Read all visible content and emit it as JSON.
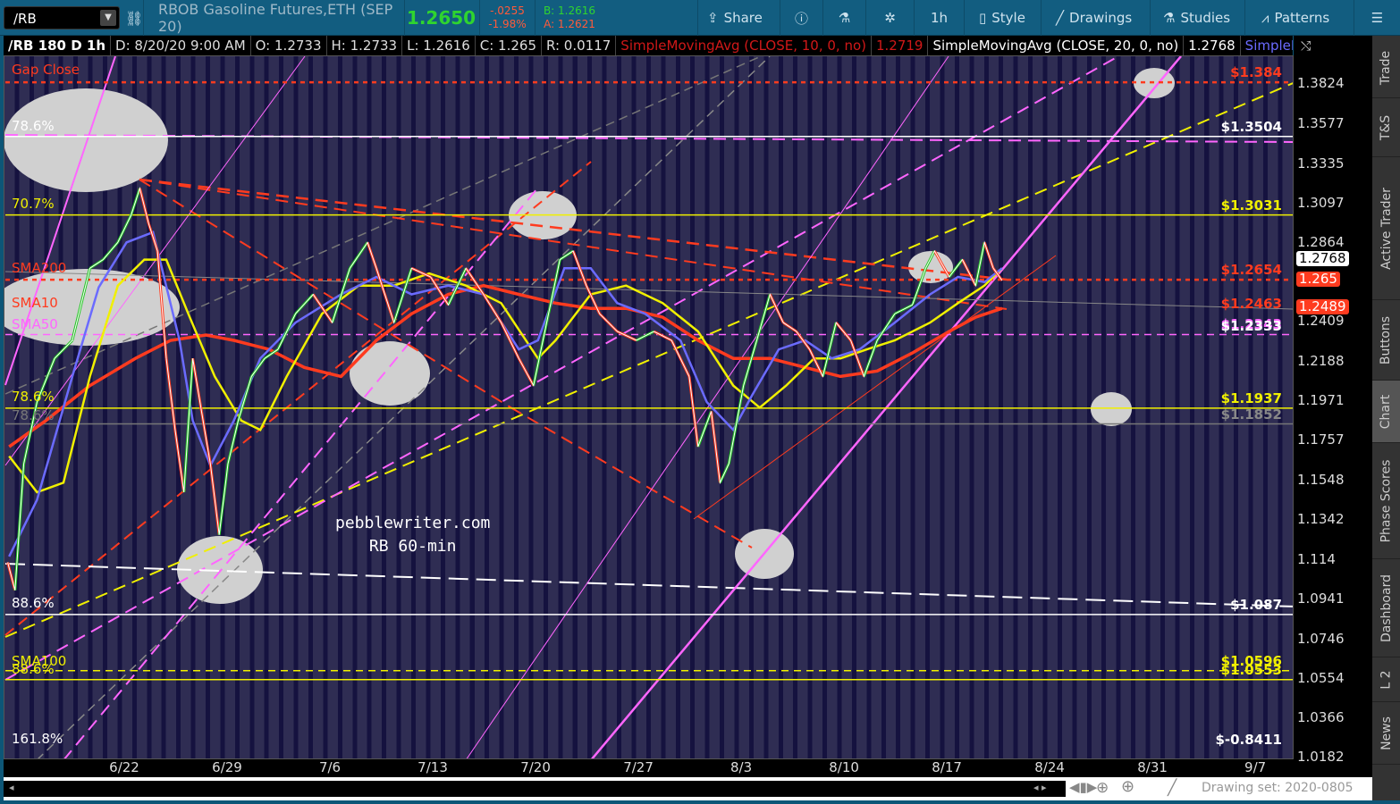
{
  "toolbar": {
    "symbol": "/RB",
    "description": "RBOB Gasoline Futures,ETH (SEP 20)",
    "last": "1.2650",
    "change": "-.0255",
    "change_pct": "-1.98%",
    "bid": "B: 1.2616",
    "ask": "A: 1.2621",
    "share": "Share",
    "interval": "1h",
    "style": "Style",
    "drawings": "Drawings",
    "studies": "Studies",
    "patterns": "Patterns"
  },
  "infobar": {
    "title": "/RB 180 D 1h",
    "date": "D: 8/20/20 9:00 AM",
    "open": "O: 1.2733",
    "high": "H: 1.2733",
    "low": "L: 1.2616",
    "close": "C: 1.265",
    "range": "R: 0.0117",
    "study1": "SimpleMovingAvg (CLOSE, 10, 0, no)",
    "study1_val": "1.2719",
    "study2": "SimpleMovingAvg (CLOSE, 20, 0, no)",
    "study2_val": "1.2768",
    "study3": "SimpleMoving..."
  },
  "price_axis": {
    "ticks": [
      "1.3824",
      "1.3577",
      "1.3335",
      "1.3097",
      "1.2864",
      "1.2409",
      "1.2188",
      "1.1971",
      "1.1757",
      "1.1548",
      "1.1342",
      "1.114",
      "1.0941",
      "1.0746",
      "1.0554",
      "1.0366",
      "1.0182"
    ],
    "badges": [
      {
        "text": "1.2768",
        "price": 1.2768,
        "bg": "#ffffff",
        "fg": "#000000"
      },
      {
        "text": "1.265",
        "price": 1.265,
        "bg": "#ff3b1f",
        "fg": "#ffffff"
      },
      {
        "text": "1.2489",
        "price": 1.2489,
        "bg": "#ff3b1f",
        "fg": "#ffffff"
      }
    ]
  },
  "date_axis": [
    {
      "label": "6/22",
      "day": 0
    },
    {
      "label": "6/29",
      "day": 7
    },
    {
      "label": "7/6",
      "day": 14
    },
    {
      "label": "7/13",
      "day": 21
    },
    {
      "label": "7/20",
      "day": 28
    },
    {
      "label": "7/27",
      "day": 35
    },
    {
      "label": "8/3",
      "day": 42
    },
    {
      "label": "8/10",
      "day": 49
    },
    {
      "label": "8/17",
      "day": 56
    },
    {
      "label": "8/24",
      "day": 63
    },
    {
      "label": "8/31",
      "day": 70
    },
    {
      "label": "9/7",
      "day": 77
    }
  ],
  "levels": [
    {
      "label": "$1.384",
      "price": 1.384,
      "color": "#ff3b1f",
      "style": "dotted"
    },
    {
      "label": "$1.3504",
      "price": 1.3504,
      "color": "#ffffff",
      "style": "solid"
    },
    {
      "label": "$1.3031",
      "price": 1.3031,
      "color": "#f0f000",
      "style": "solid"
    },
    {
      "label": "$1.2654",
      "price": 1.2654,
      "color": "#ff3b1f",
      "style": "dotted"
    },
    {
      "label": "$1.2463",
      "price": 1.2463,
      "color": "#ff3b1f",
      "style": "none"
    },
    {
      "label": "$1.2343",
      "price": 1.2343,
      "color": "#ff66ff",
      "style": "dashed"
    },
    {
      "label": "$1.2333",
      "price": 1.2333,
      "color": "#ffffff",
      "style": "none"
    },
    {
      "label": "$1.1937",
      "price": 1.1937,
      "color": "#f0f000",
      "style": "solid"
    },
    {
      "label": "$1.1852",
      "price": 1.1852,
      "color": "#777777",
      "style": "solid"
    },
    {
      "label": "$1.087",
      "price": 1.087,
      "color": "#ffffff",
      "style": "solid"
    },
    {
      "label": "$1.0596",
      "price": 1.0596,
      "color": "#f0f000",
      "style": "dashed"
    },
    {
      "label": "$1.0553",
      "price": 1.0553,
      "color": "#f0f000",
      "style": "solid"
    },
    {
      "label": "$-0.8411",
      "price": 1.0225,
      "color": "#ffffff",
      "style": "none"
    }
  ],
  "left_labels": [
    {
      "text": "Gap Close",
      "price": 1.387,
      "color": "#ff3b1f"
    },
    {
      "text": "78.6%",
      "price": 1.352,
      "color": "#ffffff"
    },
    {
      "text": "70.7%",
      "price": 1.305,
      "color": "#f0f000"
    },
    {
      "text": "SMA200",
      "price": 1.2675,
      "color": "#ff3b1f"
    },
    {
      "text": "SMA10",
      "price": 1.2475,
      "color": "#ff3b1f"
    },
    {
      "text": "SMA50",
      "price": 1.2355,
      "color": "#ff66ff"
    },
    {
      "text": "78.6%",
      "price": 1.1955,
      "color": "#f0f000"
    },
    {
      "text": "78.6%",
      "price": 1.1855,
      "color": "#777777"
    },
    {
      "text": "88.6%",
      "price": 1.0885,
      "color": "#ffffff"
    },
    {
      "text": "SMA100",
      "price": 1.0605,
      "color": "#f0f000"
    },
    {
      "text": "88.6%",
      "price": 1.0565,
      "color": "#f0f000"
    },
    {
      "text": "161.8%",
      "price": 1.0235,
      "color": "#ffffff"
    }
  ],
  "watermark": {
    "line1": "pebblewriter.com",
    "line2": "RB  60-min"
  },
  "series": {
    "price": [
      [
        -8,
        1.113
      ],
      [
        -7.5,
        1.099
      ],
      [
        -6.9,
        1.164
      ],
      [
        -6,
        1.197
      ],
      [
        -4.8,
        1.221
      ],
      [
        -3.6,
        1.231
      ],
      [
        -2.4,
        1.272
      ],
      [
        -1.5,
        1.277
      ],
      [
        -0.5,
        1.287
      ],
      [
        0.4,
        1.303
      ],
      [
        1,
        1.319
      ],
      [
        1.6,
        1.298
      ],
      [
        2.2,
        1.282
      ],
      [
        2.8,
        1.221
      ],
      [
        3.4,
        1.182
      ],
      [
        4,
        1.149
      ],
      [
        4.6,
        1.221
      ],
      [
        5.2,
        1.192
      ],
      [
        5.8,
        1.164
      ],
      [
        6.4,
        1.127
      ],
      [
        7,
        1.164
      ],
      [
        7.7,
        1.187
      ],
      [
        8.6,
        1.211
      ],
      [
        9.5,
        1.221
      ],
      [
        10.4,
        1.226
      ],
      [
        11.6,
        1.246
      ],
      [
        12.8,
        1.257
      ],
      [
        14.1,
        1.241
      ],
      [
        15.3,
        1.272
      ],
      [
        16.5,
        1.287
      ],
      [
        17.1,
        1.272
      ],
      [
        18.3,
        1.241
      ],
      [
        19.5,
        1.272
      ],
      [
        20.8,
        1.267
      ],
      [
        22,
        1.251
      ],
      [
        23.2,
        1.272
      ],
      [
        24.4,
        1.257
      ],
      [
        25.6,
        1.241
      ],
      [
        26.8,
        1.221
      ],
      [
        27.8,
        1.206
      ],
      [
        28.7,
        1.241
      ],
      [
        29.6,
        1.277
      ],
      [
        30.5,
        1.282
      ],
      [
        31.4,
        1.262
      ],
      [
        32.3,
        1.246
      ],
      [
        33.5,
        1.236
      ],
      [
        34.8,
        1.231
      ],
      [
        36,
        1.236
      ],
      [
        37.2,
        1.231
      ],
      [
        38.4,
        1.211
      ],
      [
        39,
        1.173
      ],
      [
        39.9,
        1.192
      ],
      [
        40.5,
        1.154
      ],
      [
        41.1,
        1.164
      ],
      [
        42.1,
        1.206
      ],
      [
        43,
        1.231
      ],
      [
        43.9,
        1.257
      ],
      [
        44.8,
        1.241
      ],
      [
        45.7,
        1.236
      ],
      [
        46.6,
        1.226
      ],
      [
        47.5,
        1.211
      ],
      [
        48.4,
        1.241
      ],
      [
        49.4,
        1.231
      ],
      [
        50.3,
        1.211
      ],
      [
        51.2,
        1.231
      ],
      [
        52.4,
        1.246
      ],
      [
        53.6,
        1.251
      ],
      [
        54.5,
        1.272
      ],
      [
        55.1,
        1.282
      ],
      [
        56.1,
        1.267
      ],
      [
        57,
        1.277
      ],
      [
        57.9,
        1.262
      ],
      [
        58.5,
        1.287
      ],
      [
        59.1,
        1.272
      ],
      [
        59.7,
        1.265
      ]
    ],
    "sma50": [
      [
        -7.9,
        1.116
      ],
      [
        -6,
        1.145
      ],
      [
        -3.6,
        1.211
      ],
      [
        -1.8,
        1.261
      ],
      [
        0.1,
        1.287
      ],
      [
        1.9,
        1.293
      ],
      [
        3.7,
        1.231
      ],
      [
        4.6,
        1.187
      ],
      [
        5.8,
        1.163
      ],
      [
        7.4,
        1.187
      ],
      [
        9.2,
        1.221
      ],
      [
        11.6,
        1.241
      ],
      [
        14.7,
        1.257
      ],
      [
        17.1,
        1.267
      ],
      [
        19.5,
        1.257
      ],
      [
        22,
        1.262
      ],
      [
        24.4,
        1.257
      ],
      [
        26.8,
        1.226
      ],
      [
        28.1,
        1.231
      ],
      [
        29.9,
        1.272
      ],
      [
        31.7,
        1.272
      ],
      [
        33.5,
        1.252
      ],
      [
        35.4,
        1.246
      ],
      [
        37.8,
        1.231
      ],
      [
        39.6,
        1.197
      ],
      [
        41.4,
        1.182
      ],
      [
        42.7,
        1.201
      ],
      [
        44.5,
        1.226
      ],
      [
        46.3,
        1.231
      ],
      [
        48.1,
        1.221
      ],
      [
        50,
        1.226
      ],
      [
        52.4,
        1.241
      ],
      [
        54.8,
        1.257
      ],
      [
        56.7,
        1.267
      ],
      [
        58.5,
        1.264
      ],
      [
        59.7,
        1.272
      ]
    ],
    "sma100": [
      [
        -7.9,
        1.168
      ],
      [
        -6,
        1.149
      ],
      [
        -4.2,
        1.154
      ],
      [
        -2.4,
        1.211
      ],
      [
        -0.5,
        1.262
      ],
      [
        1.3,
        1.277
      ],
      [
        2.8,
        1.277
      ],
      [
        4.3,
        1.246
      ],
      [
        6.1,
        1.211
      ],
      [
        7.9,
        1.187
      ],
      [
        9.2,
        1.182
      ],
      [
        11,
        1.211
      ],
      [
        13.4,
        1.246
      ],
      [
        15.9,
        1.262
      ],
      [
        18.3,
        1.262
      ],
      [
        20.7,
        1.269
      ],
      [
        23.2,
        1.262
      ],
      [
        25.6,
        1.252
      ],
      [
        28.1,
        1.221
      ],
      [
        29.3,
        1.231
      ],
      [
        31.7,
        1.257
      ],
      [
        34.1,
        1.262
      ],
      [
        36.6,
        1.252
      ],
      [
        39,
        1.236
      ],
      [
        41.4,
        1.206
      ],
      [
        43.2,
        1.194
      ],
      [
        45,
        1.206
      ],
      [
        46.9,
        1.221
      ],
      [
        48.7,
        1.221
      ],
      [
        50.5,
        1.226
      ],
      [
        52.4,
        1.231
      ],
      [
        54.8,
        1.241
      ],
      [
        56.7,
        1.252
      ],
      [
        58.5,
        1.262
      ],
      [
        59.7,
        1.272
      ]
    ],
    "sma200": [
      [
        -7.9,
        1.173
      ],
      [
        -5.4,
        1.187
      ],
      [
        -2.4,
        1.206
      ],
      [
        0.7,
        1.221
      ],
      [
        3.1,
        1.231
      ],
      [
        5.5,
        1.234
      ],
      [
        7.4,
        1.231
      ],
      [
        9.8,
        1.226
      ],
      [
        12.2,
        1.216
      ],
      [
        14.7,
        1.211
      ],
      [
        17.1,
        1.231
      ],
      [
        19.5,
        1.246
      ],
      [
        22,
        1.257
      ],
      [
        24.4,
        1.262
      ],
      [
        26.8,
        1.257
      ],
      [
        29.3,
        1.252
      ],
      [
        31.7,
        1.249
      ],
      [
        34.1,
        1.249
      ],
      [
        36.6,
        1.244
      ],
      [
        39,
        1.231
      ],
      [
        41.4,
        1.221
      ],
      [
        43.9,
        1.221
      ],
      [
        46.3,
        1.216
      ],
      [
        48.7,
        1.211
      ],
      [
        51.2,
        1.214
      ],
      [
        53.6,
        1.224
      ],
      [
        56.1,
        1.236
      ],
      [
        57.9,
        1.244
      ],
      [
        59.7,
        1.249
      ]
    ],
    "colors": {
      "up": "#22c422",
      "down": "#ff3b1f",
      "sma50": "#6b6bff",
      "sma100": "#f0f000",
      "sma200": "#ff3b1f"
    }
  },
  "scrollbar": {
    "drawing_set": "Drawing set: 2020-0805"
  },
  "side_tabs": [
    "Trade",
    "T&S",
    "Active Trader",
    "Buttons",
    "Chart",
    "Phase Scores",
    "Dashboard",
    "L 2",
    "News"
  ]
}
